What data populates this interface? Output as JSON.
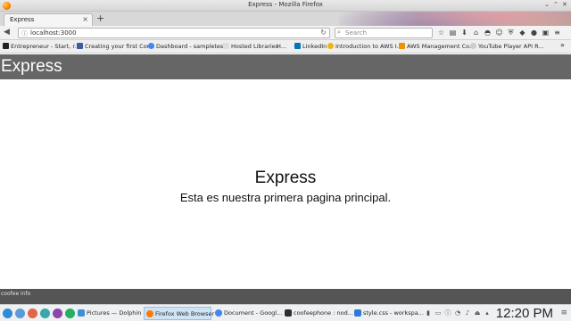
{
  "window": {
    "title": "Express - Mozilla Firefox"
  },
  "tabs": [
    {
      "label": "Express"
    }
  ],
  "navbar": {
    "url": "localhost:3000",
    "search_placeholder": "Search"
  },
  "bookmarks": [
    {
      "label": "Entrepreneur - Start, r...",
      "color": "#222222"
    },
    {
      "label": "Creating your first Cor...",
      "color": "#3b5b9c"
    },
    {
      "label": "Dashboard - sampletest",
      "color": "#4285f4"
    },
    {
      "label": "Hosted Libraries",
      "color": "#dddddd"
    },
    {
      "label": "H...",
      "color": "#dddddd"
    },
    {
      "label": "LinkedIn",
      "color": "#0077b5"
    },
    {
      "label": "Introduction to AWS I...",
      "color": "#f2b40f"
    },
    {
      "label": "AWS Management Co...",
      "color": "#f29100"
    },
    {
      "label": "YouTube Player API R...",
      "color": "#cccccc"
    }
  ],
  "page": {
    "header_title": "Express",
    "title": "Express",
    "text": "Esta es nuestra primera pagina principal.",
    "footer": "coofee info",
    "header_color": "#666666",
    "footer_color": "#555555"
  },
  "taskbar": {
    "tasks": [
      {
        "label": "Pictures — Dolphin",
        "color": "#3d8fd6",
        "active": false
      },
      {
        "label": "Firefox Web Browser",
        "color": "#ff7a00",
        "active": true
      },
      {
        "label": "Document - Googl...",
        "color": "#4285f4",
        "active": false
      },
      {
        "label": "coofeephone : nod...",
        "color": "#2e2e2e",
        "active": false
      },
      {
        "label": "style.css - workspa...",
        "color": "#2a7ad6",
        "active": false
      }
    ],
    "clock": "12:20 PM"
  }
}
